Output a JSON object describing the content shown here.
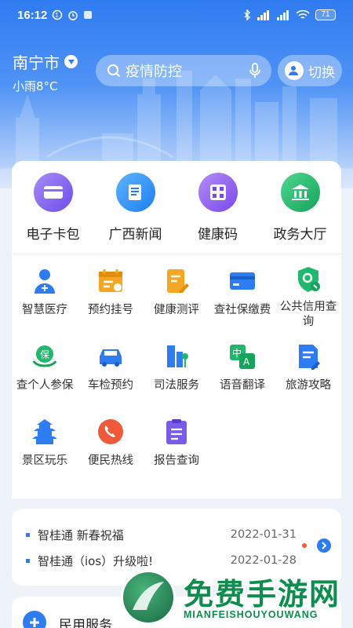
{
  "status_bar": {
    "time": "16:12",
    "battery": "71"
  },
  "header": {
    "city": "南宁市",
    "weather": "小雨8°C",
    "search_placeholder": "疫情防控",
    "switch_label": "切换"
  },
  "quick_actions": [
    {
      "label": "电子卡包",
      "icon": "card-wallet-icon",
      "color": "#7b5cf0"
    },
    {
      "label": "广西新闻",
      "icon": "news-icon",
      "color": "#2d8cf5"
    },
    {
      "label": "健康码",
      "icon": "qr-code-icon",
      "color": "#8a5cf2"
    },
    {
      "label": "政务大厅",
      "icon": "government-hall-icon",
      "color": "#1fb86c"
    }
  ],
  "services": [
    {
      "label": "智慧医疗",
      "icon": "doctor-icon"
    },
    {
      "label": "预约挂号",
      "icon": "calendar-icon"
    },
    {
      "label": "健康测评",
      "icon": "clipboard-edit-icon"
    },
    {
      "label": "查社保缴费",
      "icon": "credit-card-icon"
    },
    {
      "label": "公共信用查询",
      "icon": "shield-search-icon"
    },
    {
      "label": "查个人参保",
      "icon": "insurance-icon"
    },
    {
      "label": "车检预约",
      "icon": "car-icon"
    },
    {
      "label": "司法服务",
      "icon": "courthouse-icon"
    },
    {
      "label": "语音翻译",
      "icon": "translate-icon"
    },
    {
      "label": "旅游攻略",
      "icon": "travel-guide-icon"
    },
    {
      "label": "景区玩乐",
      "icon": "pagoda-icon"
    },
    {
      "label": "便民热线",
      "icon": "phone-icon"
    },
    {
      "label": "报告查询",
      "icon": "report-icon"
    }
  ],
  "news": [
    {
      "title": "智桂通  新春祝福",
      "date": "2022-01-31"
    },
    {
      "title": "智桂通（ios）升级啦!",
      "date": "2022-01-28"
    }
  ],
  "civil_section": {
    "title": "民用服务"
  },
  "watermark": {
    "title": "免费手游网",
    "subtitle": "MIANFEISHOUYOUWANG"
  },
  "colors": {
    "primary": "#2d7cf2",
    "hero_top": "#2f7bf1",
    "accent_orange": "#f5a623",
    "accent_green": "#1fb86c"
  }
}
